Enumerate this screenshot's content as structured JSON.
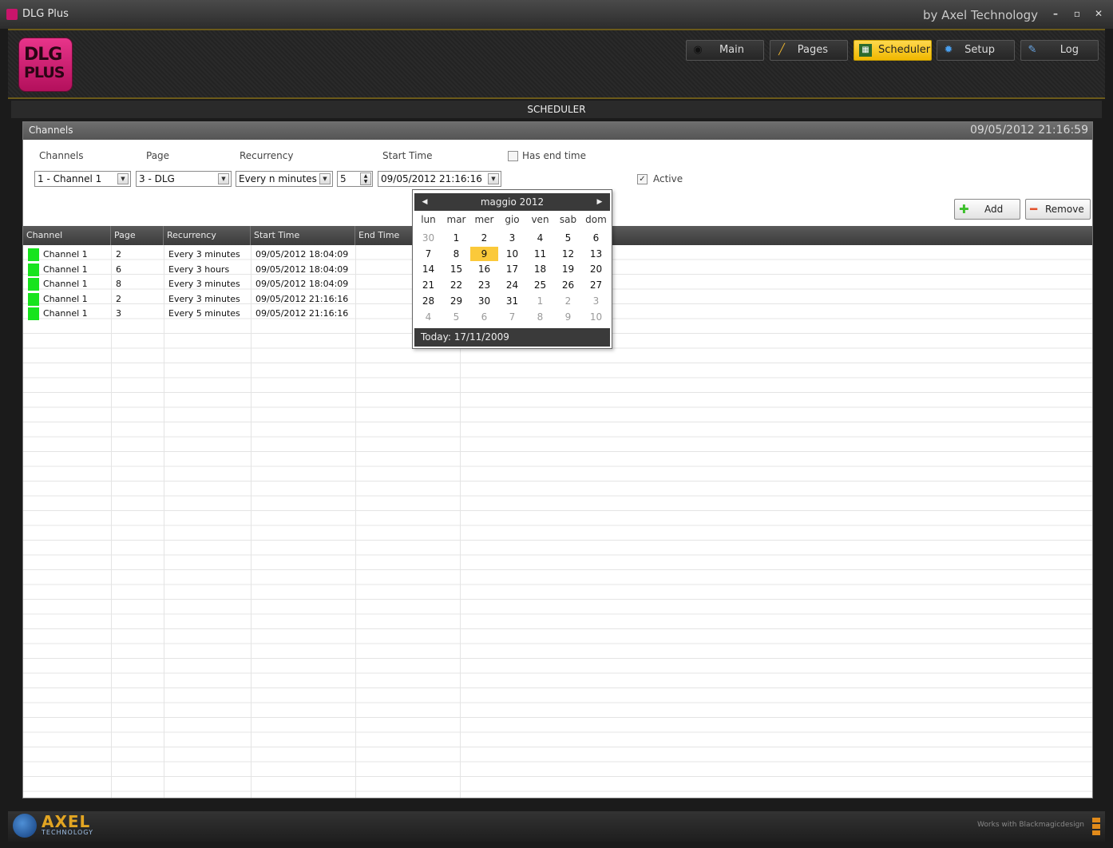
{
  "window": {
    "title": "DLG Plus",
    "brand": "by Axel Technology",
    "buttons": [
      "–",
      "▫",
      "✕"
    ]
  },
  "logo": {
    "line1": "DLG",
    "line2": "PLUS"
  },
  "nav": [
    {
      "label": "Main",
      "icon": "satellite-icon"
    },
    {
      "label": "Pages",
      "icon": "pencil-icon"
    },
    {
      "label": "Scheduler",
      "icon": "calendar-icon",
      "active": true
    },
    {
      "label": "Setup",
      "icon": "gear-icon"
    },
    {
      "label": "Log",
      "icon": "log-icon"
    }
  ],
  "section_title": "SCHEDULER",
  "panel": {
    "title": "Channels",
    "datetime": "09/05/2012 21:16:59"
  },
  "form": {
    "channels_label": "Channels",
    "page_label": "Page",
    "recurrency_label": "Recurrency",
    "start_time_label": "Start Time",
    "has_end_time_label": "Has end time",
    "active_label": "Active",
    "channel_value": "1 - Channel 1",
    "page_value": "3 - DLG",
    "recurrency_value": "Every n minutes",
    "interval_value": "5",
    "start_time_value": "09/05/2012  21:16:16",
    "has_end_time_checked": false,
    "active_checked": true,
    "add_label": "Add",
    "remove_label": "Remove"
  },
  "grid": {
    "columns": [
      "Channel",
      "Page",
      "Recurrency",
      "Start Time",
      "End Time"
    ],
    "rows": [
      {
        "channel": "Channel 1",
        "page": "2",
        "recurrency": "Every 3 minutes",
        "start": "09/05/2012 18:04:09",
        "end": "",
        "color": "#17e41d"
      },
      {
        "channel": "Channel 1",
        "page": "6",
        "recurrency": "Every 3 hours",
        "start": "09/05/2012 18:04:09",
        "end": "",
        "color": "#17e41d"
      },
      {
        "channel": "Channel 1",
        "page": "8",
        "recurrency": "Every 3 minutes",
        "start": "09/05/2012 18:04:09",
        "end": "",
        "color": "#17e41d"
      },
      {
        "channel": "Channel 1",
        "page": "2",
        "recurrency": "Every 3 minutes",
        "start": "09/05/2012 21:16:16",
        "end": "",
        "color": "#17e41d"
      },
      {
        "channel": "Channel 1",
        "page": "3",
        "recurrency": "Every 5 minutes",
        "start": "09/05/2012 21:16:16",
        "end": "",
        "color": "#17e41d"
      }
    ]
  },
  "calendar": {
    "month_title": "maggio 2012",
    "weekdays": [
      "lun",
      "mar",
      "mer",
      "gio",
      "ven",
      "sab",
      "dom"
    ],
    "weeks": [
      [
        {
          "d": "30",
          "m": true
        },
        {
          "d": "1"
        },
        {
          "d": "2"
        },
        {
          "d": "3"
        },
        {
          "d": "4"
        },
        {
          "d": "5"
        },
        {
          "d": "6"
        }
      ],
      [
        {
          "d": "7"
        },
        {
          "d": "8"
        },
        {
          "d": "9",
          "sel": true
        },
        {
          "d": "10"
        },
        {
          "d": "11"
        },
        {
          "d": "12"
        },
        {
          "d": "13"
        }
      ],
      [
        {
          "d": "14"
        },
        {
          "d": "15"
        },
        {
          "d": "16"
        },
        {
          "d": "17"
        },
        {
          "d": "18"
        },
        {
          "d": "19"
        },
        {
          "d": "20"
        }
      ],
      [
        {
          "d": "21"
        },
        {
          "d": "22"
        },
        {
          "d": "23"
        },
        {
          "d": "24"
        },
        {
          "d": "25"
        },
        {
          "d": "26"
        },
        {
          "d": "27"
        }
      ],
      [
        {
          "d": "28"
        },
        {
          "d": "29"
        },
        {
          "d": "30"
        },
        {
          "d": "31"
        },
        {
          "d": "1",
          "m": true
        },
        {
          "d": "2",
          "m": true
        },
        {
          "d": "3",
          "m": true
        }
      ],
      [
        {
          "d": "4",
          "m": true
        },
        {
          "d": "5",
          "m": true
        },
        {
          "d": "6",
          "m": true
        },
        {
          "d": "7",
          "m": true
        },
        {
          "d": "8",
          "m": true
        },
        {
          "d": "9",
          "m": true
        },
        {
          "d": "10",
          "m": true
        }
      ]
    ],
    "today_label": "Today: 17/11/2009"
  },
  "footer": {
    "brand": "AXEL",
    "brand_sub": "TECHNOLOGY",
    "works_with": "Works with  Blackmagicdesign"
  }
}
